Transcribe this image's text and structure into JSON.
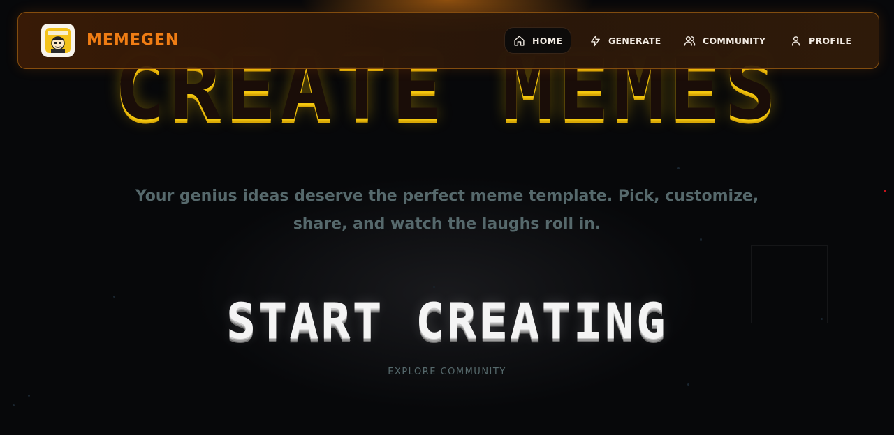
{
  "nav": {
    "brand": "MEMEGEN",
    "items": [
      {
        "label": "HOME",
        "icon": "home-icon",
        "active": true
      },
      {
        "label": "GENERATE",
        "icon": "lightning-icon",
        "active": false
      },
      {
        "label": "COMMUNITY",
        "icon": "users-icon",
        "active": false
      },
      {
        "label": "PROFILE",
        "icon": "user-icon",
        "active": false
      }
    ]
  },
  "hero": {
    "headline": "CREATE MEMES",
    "tagline": "Your genius ideas deserve the perfect meme template. Pick, customize, share, and watch the laughs roll in.",
    "cta_label": "START CREATING",
    "secondary_label": "EXPLORE COMMUNITY"
  },
  "colors": {
    "accent": "#f07d14",
    "headline_yellow": "#f3c70f",
    "muted_text": "#56696c",
    "background": "#07080a"
  }
}
